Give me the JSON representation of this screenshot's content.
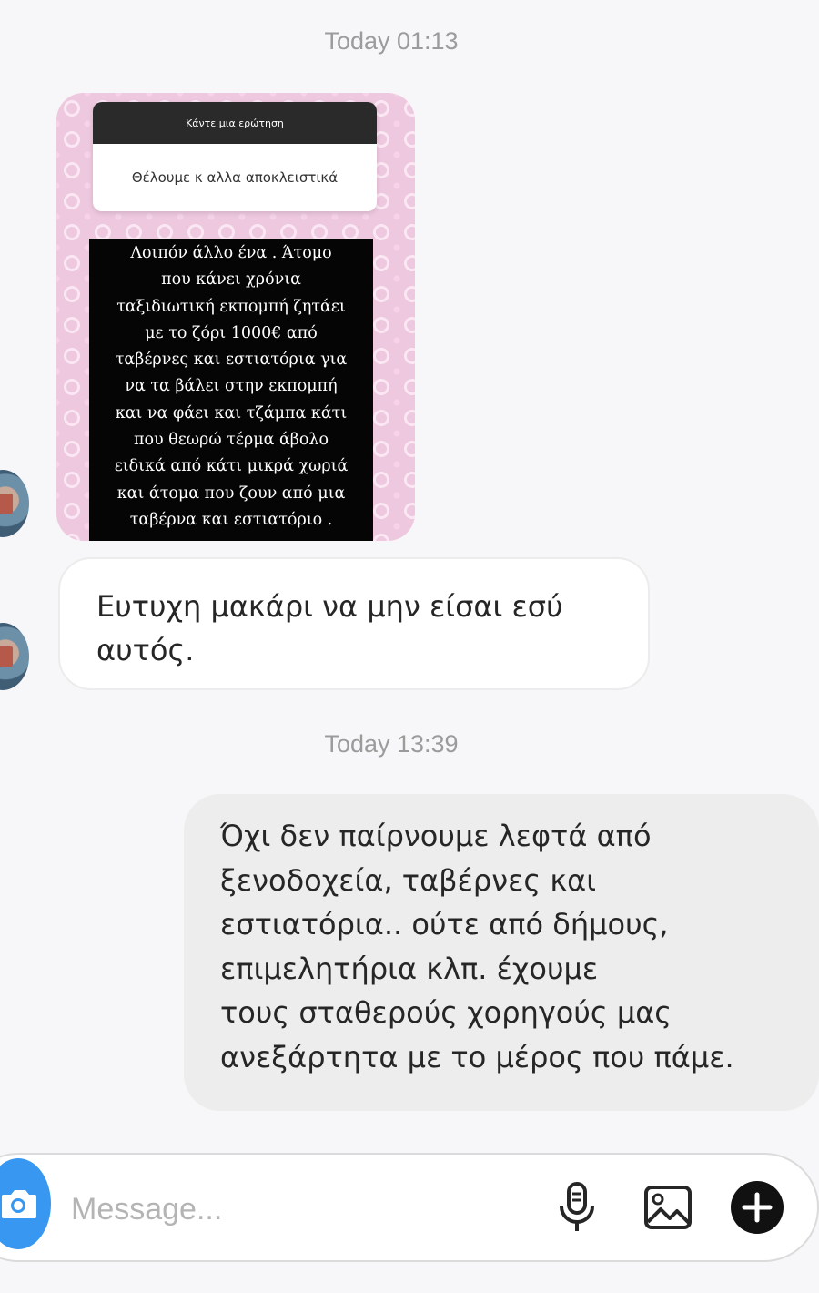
{
  "timestamps": [
    "Today 01:13",
    "Today 13:39"
  ],
  "story": {
    "question_header": "Κάντε μια ερώτηση",
    "question_text": "Θέλουμε κ αλλα αποκλειστικά",
    "text": "Λοιπόν άλλο ένα . Άτομο\nπου κάνει χρόνια\nταξιδιωτική εκπομπή ζητάει\nμε το ζόρι 1000€ από\nταβέρνες και εστιατόρια για\nνα τα βάλει στην εκπομπή\nκαι να φάει και τζάμπα κάτι\nπου θεωρώ τέρμα άβολο\nειδικά από κάτι μικρά χωριά\nκαι άτομα που ζουν από μια\nταβέρνα και εστιατόριο ."
  },
  "messages": {
    "received": "Ευτυχη μακάρι να μην είσαι εσύ αυτός.",
    "sent": "Όχι δεν παίρνουμε λεφτά από\nξενοδοχεία, ταβέρνες και\nεστιατόρια.. ούτε από δήμους,\nεπιμελητήρια κλπ. έχουμε\nτους σταθερούς χορηγούς μας\nανεξάρτητα με το μέρος που πάμε."
  },
  "composer": {
    "placeholder": "Message...",
    "icons": [
      "camera-icon",
      "microphone-icon",
      "gallery-icon",
      "plus-icon"
    ]
  },
  "colors": {
    "accent": "#3897f0",
    "sent_bubble": "#ededed",
    "received_bubble": "#ffffff"
  }
}
